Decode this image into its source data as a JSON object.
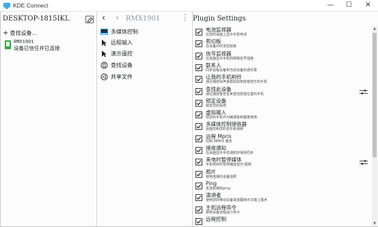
{
  "window": {
    "title": "KDE Connect",
    "minimize_glyph": "—",
    "maximize_glyph": "☐",
    "close_glyph": "✕"
  },
  "left": {
    "host_name": "DESKTOP-1815IKL",
    "find_devices_label": "查找设备...",
    "device": {
      "name": "RMX1901",
      "status": "设备已信任并已连接"
    }
  },
  "middle": {
    "back_glyph": "‹",
    "forward_glyph": "›",
    "page_title": "RMX1901",
    "actions": [
      {
        "label": "多媒体控制",
        "icon": "media-player-icon"
      },
      {
        "label": "远程输入",
        "icon": "pointer-icon"
      },
      {
        "label": "演示遥控",
        "icon": "pointer-icon"
      },
      {
        "label": "查找设备",
        "icon": "phone-ring-icon"
      },
      {
        "label": "共享文件",
        "icon": "share-icon"
      }
    ]
  },
  "settings": {
    "title": "Plugin Settings",
    "plugins": [
      {
        "name": "电池监视器",
        "desc": "在您的桌面上显示手机电池",
        "checked": true,
        "configurable": false
      },
      {
        "name": "剪切板",
        "desc": "在设备间共享剪贴板",
        "checked": true,
        "configurable": false
      },
      {
        "name": "信号监视器",
        "desc": "在桌面显示手机的网络信号强度",
        "checked": true,
        "configurable": false
      },
      {
        "name": "联系人",
        "desc": "同步远程设备和当前设备的通讯录",
        "checked": true,
        "configurable": false
      },
      {
        "name": "让我的手机响铃",
        "desc": "通过播放铃声来帮助找到放错地方的手机",
        "checked": true,
        "configurable": false
      },
      {
        "name": "查找此设备",
        "desc": "通过播放警告音来查找放错位置的手机",
        "checked": true,
        "configurable": true
      },
      {
        "name": "锁定设备",
        "desc": "锁定您的系统",
        "checked": true,
        "configurable": false
      },
      {
        "name": "虚拟输入",
        "desc": "把您的手机作为触摸板和键盘使用",
        "checked": true,
        "configurable": false
      },
      {
        "name": "多媒体控制接收器",
        "desc": "远程控制您的音乐和视频",
        "checked": true,
        "configurable": false
      },
      {
        "name": "远程 Mpris",
        "desc": "控制 MPRIS 服务",
        "checked": true,
        "configurable": false
      },
      {
        "name": "接收通知",
        "desc": "在桌面显示手机通知并保持同步",
        "checked": true,
        "configurable": false
      },
      {
        "name": "来电时暂停媒体",
        "desc": "手机响铃时暂停播放音乐/视频",
        "checked": true,
        "configurable": true
      },
      {
        "name": "照片",
        "desc": "使用连接的设备拍照",
        "checked": true,
        "configurable": false
      },
      {
        "name": "Ping",
        "desc": "发送和接收ping",
        "checked": true,
        "configurable": false
      },
      {
        "name": "演讲者",
        "desc": "使用您的移动设备来放翻演示文稿上报术",
        "checked": true,
        "configurable": false
      },
      {
        "name": "主机远程命令",
        "desc": "使用设备远程运行命令",
        "checked": true,
        "configurable": false
      },
      {
        "name": "远程控制",
        "desc": "",
        "checked": true,
        "configurable": false
      }
    ]
  },
  "colors": {
    "accent": "#2ea83f",
    "background": "#fcfcfc",
    "text": "#232629"
  }
}
